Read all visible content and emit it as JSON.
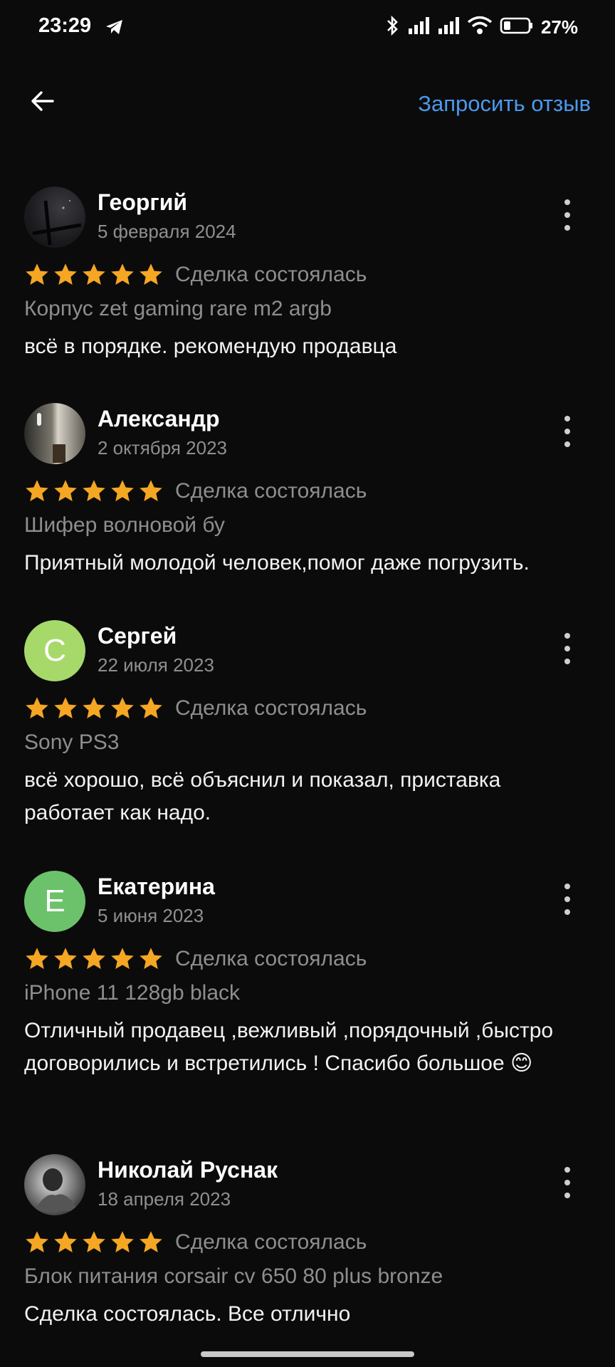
{
  "status_bar": {
    "time": "23:29",
    "battery": "27%",
    "icons": [
      "telegram-icon",
      "bluetooth-icon",
      "signal-icon",
      "signal-icon",
      "wifi-icon",
      "battery-icon"
    ]
  },
  "header": {
    "back_icon": "arrow-left-icon",
    "request_review": "Запросить отзыв",
    "link_color": "#4c99ee"
  },
  "star_color": "#f5a623",
  "reviews": [
    {
      "name": "Георгий",
      "date": "5 февраля 2024",
      "rating": 5,
      "deal": "Сделка состоялась",
      "item": "Корпус zet gaming rare m2 argb",
      "text": "всё в порядке. рекомендую продавца",
      "avatar": "photo"
    },
    {
      "name": "Александр",
      "date": "2 октября 2023",
      "rating": 5,
      "deal": "Сделка состоялась",
      "item": "Шифер волновой бу",
      "text": "Приятный молодой человек,помог даже погрузить.",
      "avatar": "photo"
    },
    {
      "name": "Сергей",
      "date": "22 июля 2023",
      "rating": 5,
      "deal": "Сделка состоялась",
      "item": "Sony PS3",
      "text": "всё хорошо, всё объяснил и показал, приставка работает как надо.",
      "avatar_letter": "С",
      "avatar_color": "#a6d96a"
    },
    {
      "name": "Екатерина",
      "date": "5 июня 2023",
      "rating": 5,
      "deal": "Сделка состоялась",
      "item": "iPhone 11 128gb black",
      "text": "Отличный продавец ,вежливый ,порядочный ,быстро договорились и встретились ! Спасибо большое 😊",
      "avatar_letter": "Е",
      "avatar_color": "#6cc26a"
    },
    {
      "name": "Николай Руснак",
      "date": "18 апреля 2023",
      "rating": 5,
      "deal": "Сделка состоялась",
      "item": "Блок питания corsair cv 650 80 plus bronze",
      "text": "Сделка состоялась. Все отлично",
      "avatar": "photo"
    }
  ]
}
